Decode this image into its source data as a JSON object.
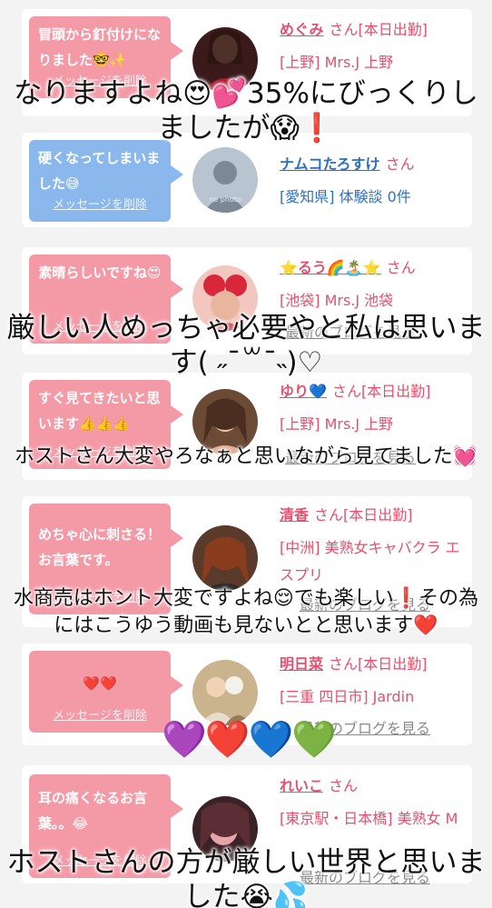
{
  "cards": [
    {
      "message": "冒頭から釘付けになりました🤓✨",
      "delete_label": "メッセージを削除",
      "name": "めぐみ",
      "suffix": "さん[本日出勤]",
      "shop": "[上野] Mrs.J 上野",
      "blog": ""
    },
    {
      "message": "硬くなってしまいました😅",
      "delete_label": "メッセージを削除",
      "name": "ナムコたろすけ",
      "suffix": "さん",
      "shop": "[愛知県] 体験談 0件",
      "blog": "",
      "avatar_text": "no photo"
    },
    {
      "message": "素晴らしいですね😍",
      "delete_label": "メッセージを削除",
      "name": "⭐るう🌈🏝️⭐",
      "suffix": "さん",
      "shop": "[池袋] Mrs.J 池袋",
      "blog": "最新のブログを見る"
    },
    {
      "message": "すぐ見てきたいと思います👍👍👍",
      "delete_label": "メッセージを削除",
      "name": "ゆり💙",
      "suffix": "さん[本日出勤]",
      "shop": "[上野] Mrs.J 上野",
      "blog": "最新のブログを見る"
    },
    {
      "message": "めちゃ心に刺さる！お言葉です。",
      "delete_label": "メッセージを削除",
      "name": "清香",
      "suffix": "さん[本日出勤]",
      "shop": "[中洲] 美熟女キャバクラ エスプリ",
      "blog": "最新のブログを見る"
    },
    {
      "message": "❤️❤️",
      "delete_label": "メッセージを削除",
      "name": "明日菜",
      "suffix": "さん[本日出勤]",
      "shop": "[三重 四日市] Jardin",
      "blog": "最新のブログを見る"
    },
    {
      "message": "耳の痛くなるお言葉。。😂",
      "delete_label": "メッセージを削除",
      "name": "れいこ",
      "suffix": "さん",
      "shop": "[東京駅・日本橋] 美熟女 M",
      "blog": "最新のブログを見る"
    }
  ],
  "overlays": [
    "なりますよね😍💕35%にびっくりしましたが😱❗️",
    "厳しい人めっちゃ必要やと私は思います( ˶¯꒳¯˵)♡",
    "ホストさん大変やろなぁと思いながら見てました💓",
    "水商売はホント大変ですよね😌でも楽しい❗️その為にはこうゆう動画も見ないとと思います❤️",
    "💜❤️💙💚",
    "ホストさんの方が厳しい世界と思いました😭💦"
  ],
  "colors": {
    "bubble_pink": "#f49aa7",
    "bubble_blue": "#8ab8ec",
    "name_pink": "#e4506e",
    "name_blue": "#2f6fbf",
    "background": "#f3f3f3"
  }
}
